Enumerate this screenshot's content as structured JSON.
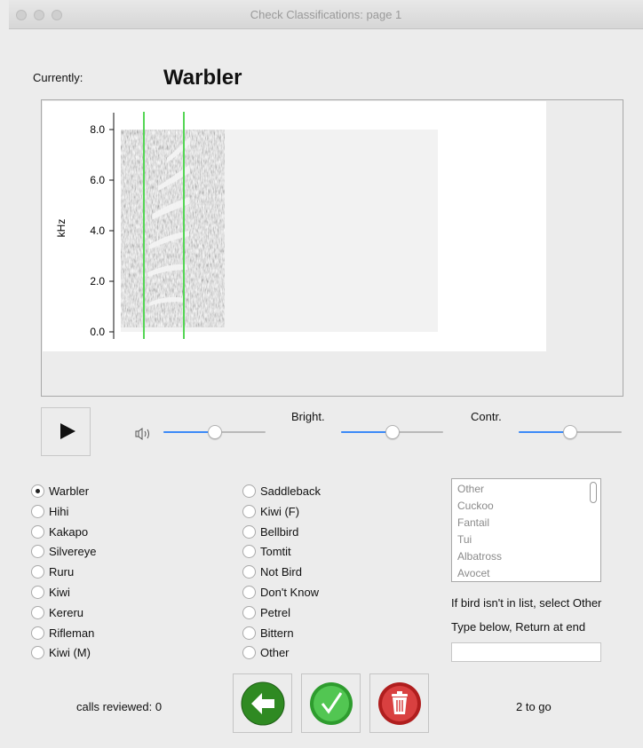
{
  "window": {
    "title": "Check Classifications: page 1"
  },
  "header": {
    "currently_label": "Currently:",
    "current_value": "Warbler"
  },
  "spectrogram": {
    "ylabel": "kHz",
    "ticks": [
      "8.0",
      "6.0",
      "4.0",
      "2.0",
      "0.0"
    ],
    "marker_color": "#55d655"
  },
  "controls": {
    "play_icon": "play-icon",
    "volume_icon": "speaker-icon",
    "volume_level": 0.5,
    "bright_label": "Bright.",
    "bright_level": 0.5,
    "contr_label": "Contr.",
    "contr_level": 0.5,
    "accent": "#3b8af7"
  },
  "species_col1": [
    "Warbler",
    "Hihi",
    "Kakapo",
    "Silvereye",
    "Ruru",
    "Kiwi",
    "Kereru",
    "Rifleman",
    "Kiwi (M)"
  ],
  "species_col2": [
    "Saddleback",
    "Kiwi (F)",
    "Bellbird",
    "Tomtit",
    "Not Bird",
    "Don't Know",
    "Petrel",
    "Bittern",
    "Other"
  ],
  "selected_species": "Warbler",
  "other_list": [
    "Other",
    "Cuckoo",
    "Fantail",
    "Tui",
    "Albatross",
    "Avocet"
  ],
  "hint_list": "If bird isn't in list, select Other",
  "hint_type": "Type below, Return at end",
  "typed_text": "",
  "footer": {
    "reviewed": "calls reviewed: 0",
    "to_go": "2 to go"
  },
  "buttons": {
    "back_icon": "back-arrow-icon",
    "confirm_icon": "check-icon",
    "delete_icon": "trash-icon"
  }
}
